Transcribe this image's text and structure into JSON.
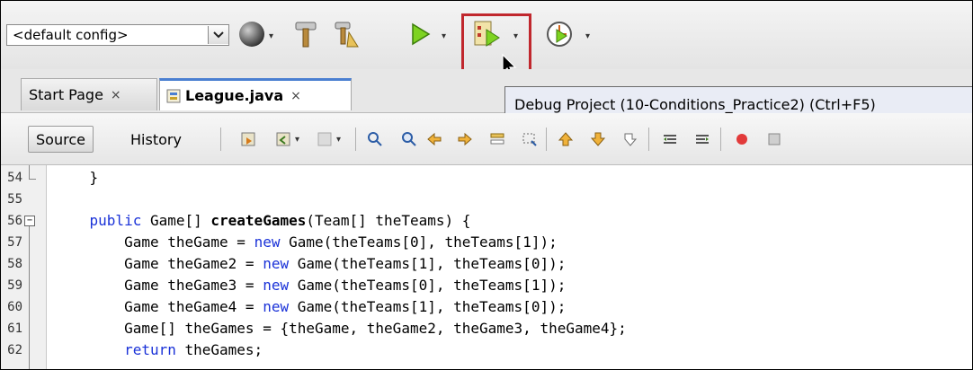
{
  "toolbar": {
    "config_value": "<default config>",
    "dropdown_arrow": "▾",
    "icons": [
      "globe-icon",
      "build-hammer-icon",
      "clean-build-icon",
      "run-icon",
      "debug-project-icon",
      "profile-icon"
    ]
  },
  "tabs": [
    {
      "label": "Start Page",
      "close": "×"
    },
    {
      "label": "League.java",
      "close": "×"
    }
  ],
  "tooltip": {
    "text": "Debug Project (10-Conditions_Practice2) (Ctrl+F5)"
  },
  "editor": {
    "source_label": "Source",
    "history_label": "History"
  },
  "code": {
    "lines": [
      {
        "num": "54",
        "text": "    }"
      },
      {
        "num": "55",
        "text": ""
      },
      {
        "num": "56",
        "pre": "    public Game[] ",
        "bold": "createGames",
        "post": "(Team[] theTeams) {"
      },
      {
        "num": "57",
        "pre": "        Game theGame = ",
        "kw": "new",
        "post": " Game(theTeams[0], theTeams[1]);"
      },
      {
        "num": "58",
        "pre": "        Game theGame2 = ",
        "kw": "new",
        "post": " Game(theTeams[1], theTeams[0]);"
      },
      {
        "num": "59",
        "pre": "        Game theGame3 = ",
        "kw": "new",
        "post": " Game(theTeams[0], theTeams[1]);"
      },
      {
        "num": "60",
        "pre": "        Game theGame4 = ",
        "kw": "new",
        "post": " Game(theTeams[1], theTeams[0]);"
      },
      {
        "num": "61",
        "text": "        Game[] theGames = {theGame, theGame2, theGame3, theGame4};"
      },
      {
        "num": "62",
        "kwfirst": "return",
        "post": " theGames;"
      }
    ]
  },
  "colors": {
    "accent": "#4a7fd1",
    "highlight": "#c0272d",
    "keyword": "#1a32d8"
  }
}
